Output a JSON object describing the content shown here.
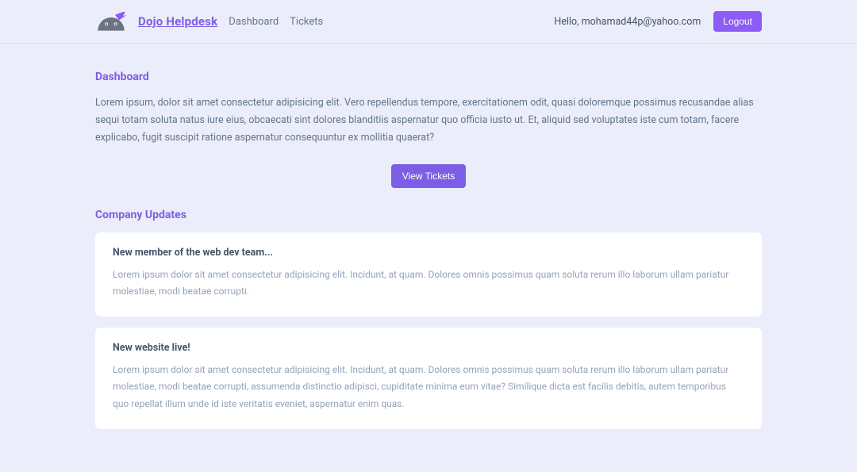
{
  "brand": "Dojo Helpdesk",
  "nav": {
    "links": [
      "Dashboard",
      "Tickets"
    ]
  },
  "user": {
    "greeting": "Hello, mohamad44p@yahoo.com",
    "logout": "Logout"
  },
  "dashboard": {
    "title": "Dashboard",
    "intro": "Lorem ipsum, dolor sit amet consectetur adipisicing elit. Vero repellendus tempore, exercitationem odit, quasi doloremque possimus recusandae alias sequi totam soluta natus iure eius, obcaecati sint dolores blanditiis aspernatur quo officia iusto ut. Et, aliquid sed voluptates iste cum totam, facere explicabo, fugit suscipit ratione aspernatur consequuntur ex mollitia quaerat?",
    "view_tickets_label": "View Tickets"
  },
  "updates": {
    "title": "Company Updates",
    "items": [
      {
        "title": "New member of the web dev team...",
        "body": "Lorem ipsum dolor sit amet consectetur adipisicing elit. Incidunt, at quam. Dolores omnis possimus quam soluta rerum illo laborum ullam pariatur molestiae, modi beatae corrupti."
      },
      {
        "title": "New website live!",
        "body": "Lorem ipsum dolor sit amet consectetur adipisicing elit. Incidunt, at quam. Dolores omnis possimus quam soluta rerum illo laborum ullam pariatur molestiae, modi beatae corrupti, assumenda distinctio adipisci, cupiditate minima eum vitae? Similique dicta est facilis debitis, autem temporibus quo repellat illum unde id iste veritatis eveniet, aspernatur enim quas."
      }
    ]
  }
}
